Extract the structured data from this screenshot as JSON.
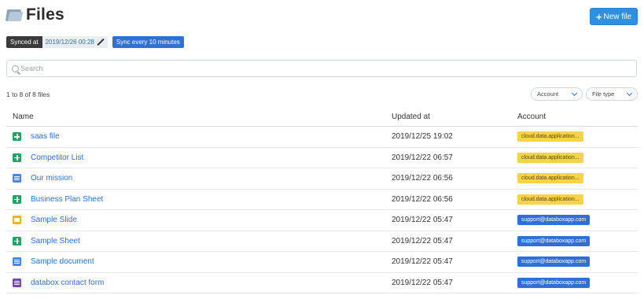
{
  "header": {
    "title": "Files",
    "folder_icon": "folder-icon"
  },
  "actions": {
    "new_file_label": "New file",
    "new_file_icon": "plus-icon"
  },
  "sync": {
    "synced_label": "Synced at",
    "synced_date": "2019/12/26 00:28",
    "edit_icon": "pencil-icon",
    "sync_button_label": "Sync every 10 minutes"
  },
  "search": {
    "placeholder": "Search",
    "value": ""
  },
  "list": {
    "count_text": "1 to 8 of 8 files"
  },
  "filters": {
    "account": {
      "label": "Account"
    },
    "file_type": {
      "label": "File type"
    }
  },
  "table": {
    "columns": [
      "Name",
      "Updated at",
      "Account"
    ],
    "rows": [
      {
        "name": "saas file",
        "type": "sheet",
        "updated_at": "2019/12/25 19:02",
        "account": "cloud.data.application...",
        "account_color": "yellow"
      },
      {
        "name": "Competitor List",
        "type": "sheet",
        "updated_at": "2019/12/22 06:57",
        "account": "cloud.data.application...",
        "account_color": "yellow"
      },
      {
        "name": "Our mission",
        "type": "doc",
        "updated_at": "2019/12/22 06:56",
        "account": "cloud.data.application...",
        "account_color": "yellow"
      },
      {
        "name": "Business Plan Sheet",
        "type": "sheet",
        "updated_at": "2019/12/22 06:56",
        "account": "cloud.data.application...",
        "account_color": "yellow"
      },
      {
        "name": "Sample Slide",
        "type": "slide",
        "updated_at": "2019/12/22 05:47",
        "account": "support@databoxapp.com",
        "account_color": "blue"
      },
      {
        "name": "Sample Sheet",
        "type": "sheet",
        "updated_at": "2019/12/22 05:47",
        "account": "support@databoxapp.com",
        "account_color": "blue"
      },
      {
        "name": "Sample document",
        "type": "doc",
        "updated_at": "2019/12/22 05:47",
        "account": "support@databoxapp.com",
        "account_color": "blue"
      },
      {
        "name": "databox contact form",
        "type": "form",
        "updated_at": "2019/12/22 05:47",
        "account": "support@databoxapp.com",
        "account_color": "blue"
      }
    ]
  },
  "colors": {
    "accent": "#2f8fe0",
    "link": "#2f6fd6",
    "badge_yellow": "#f7d34a",
    "badge_blue": "#2f6fd6",
    "sheet_icon": "#1fa463",
    "doc_icon": "#4a86e8",
    "slide_icon": "#f4b400",
    "form_icon": "#7248b9"
  }
}
